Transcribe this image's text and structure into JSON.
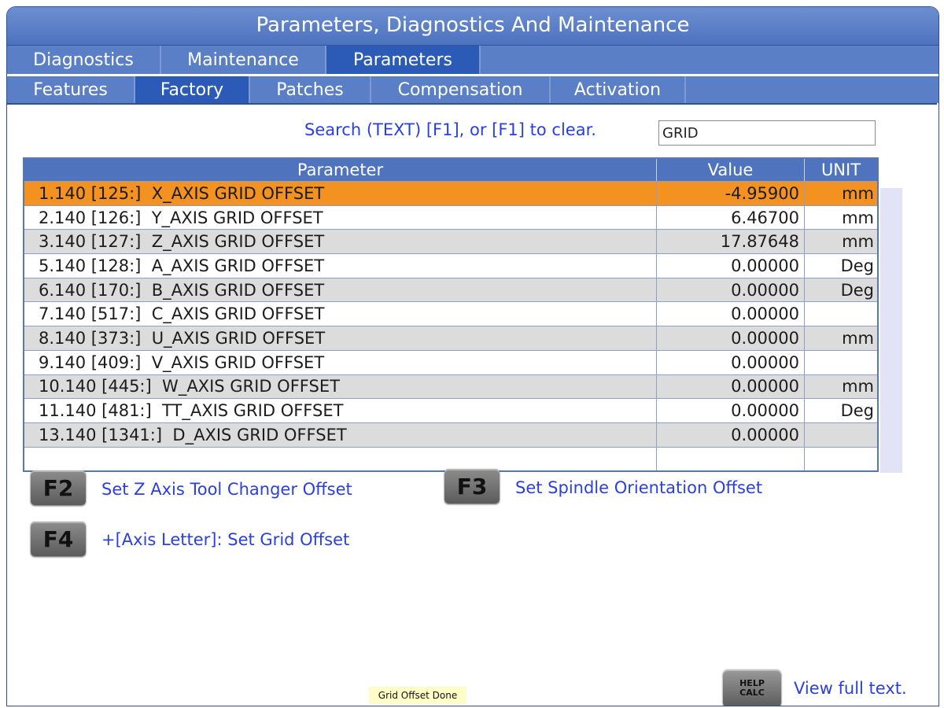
{
  "window": {
    "title": "Parameters, Diagnostics And Maintenance"
  },
  "tabs_row1": [
    {
      "label": "Diagnostics",
      "active": false
    },
    {
      "label": "Maintenance",
      "active": false
    },
    {
      "label": "Parameters",
      "active": true
    }
  ],
  "tabs_row2": [
    {
      "label": "Features",
      "active": false
    },
    {
      "label": "Factory",
      "active": true
    },
    {
      "label": "Patches",
      "active": false
    },
    {
      "label": "Compensation",
      "active": false
    },
    {
      "label": "Activation",
      "active": false
    }
  ],
  "search": {
    "label": "Search (TEXT) [F1], or [F1] to clear.",
    "value": "GRID"
  },
  "table": {
    "headers": [
      "Parameter",
      "Value",
      "UNIT"
    ],
    "rows": [
      {
        "parameter": "1.140 [125:]  X_AXIS GRID OFFSET",
        "value": "-4.95900",
        "unit": "mm"
      },
      {
        "parameter": "2.140 [126:]  Y_AXIS GRID OFFSET",
        "value": "6.46700",
        "unit": "mm"
      },
      {
        "parameter": "3.140 [127:]  Z_AXIS GRID OFFSET",
        "value": "17.87648",
        "unit": "mm"
      },
      {
        "parameter": "5.140 [128:]  A_AXIS GRID OFFSET",
        "value": "0.00000",
        "unit": "Deg"
      },
      {
        "parameter": "6.140 [170:]  B_AXIS GRID OFFSET",
        "value": "0.00000",
        "unit": "Deg"
      },
      {
        "parameter": "7.140 [517:]  C_AXIS GRID OFFSET",
        "value": "0.00000",
        "unit": ""
      },
      {
        "parameter": "8.140 [373:]  U_AXIS GRID OFFSET",
        "value": "0.00000",
        "unit": "mm"
      },
      {
        "parameter": "9.140 [409:]  V_AXIS GRID OFFSET",
        "value": "0.00000",
        "unit": ""
      },
      {
        "parameter": "10.140 [445:]  W_AXIS GRID OFFSET",
        "value": "0.00000",
        "unit": "mm"
      },
      {
        "parameter": "11.140 [481:]  TT_AXIS GRID OFFSET",
        "value": "0.00000",
        "unit": "Deg"
      },
      {
        "parameter": "13.140 [1341:]  D_AXIS GRID OFFSET",
        "value": "0.00000",
        "unit": ""
      },
      {
        "parameter": "",
        "value": "",
        "unit": ""
      }
    ],
    "selected_row": 0
  },
  "function_keys": {
    "f2": {
      "key": "F2",
      "label": "Set Z Axis Tool Changer Offset"
    },
    "f3": {
      "key": "F3",
      "label": "Set Spindle Orientation Offset"
    },
    "f4": {
      "key": "F4",
      "label": "+[Axis Letter]: Set Grid Offset"
    }
  },
  "help": {
    "key_line1": "HELP",
    "key_line2": "CALC",
    "label": "View full text."
  },
  "status": "Grid  Offset Done",
  "colors": {
    "title_bar": "#5b7fc6",
    "active_tab": "#2c5bb7",
    "selected_row": "#f39220",
    "accent_text": "#2a3fe0"
  }
}
